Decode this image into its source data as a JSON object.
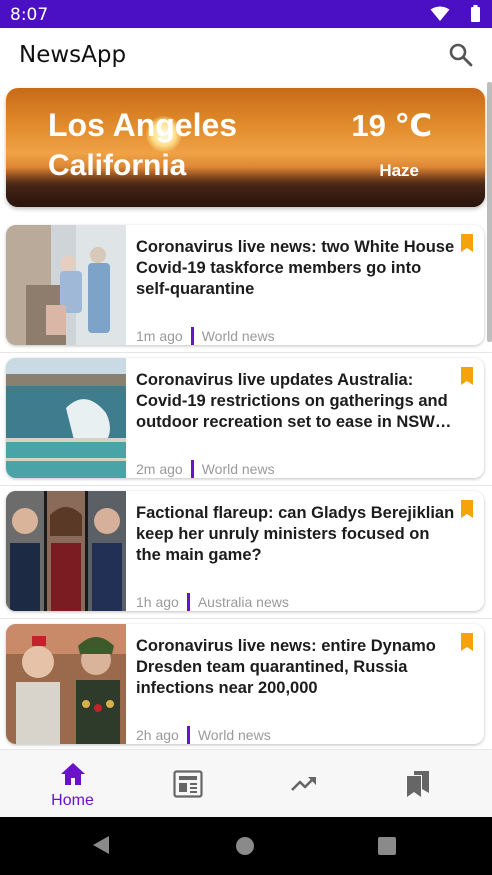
{
  "status_bar": {
    "time": "8:07"
  },
  "app_bar": {
    "title": "NewsApp",
    "search_icon": "search-icon"
  },
  "weather": {
    "city": "Los Angeles",
    "region": "California",
    "temperature": "19 ℃",
    "condition": "Haze"
  },
  "news": [
    {
      "headline": "Coronavirus live news: two White House Covid-19 taskforce members go into self-quarantine",
      "time": "1m ago",
      "category": "World news"
    },
    {
      "headline": "Coronavirus live updates Australia: Covid-19 restrictions on gatherings and outdoor recreation set to ease in NSW…",
      "time": "2m ago",
      "category": "World news"
    },
    {
      "headline": "Factional flareup: can Gladys Berejiklian keep her unruly ministers focused on the main game?",
      "time": "1h ago",
      "category": "Australia news"
    },
    {
      "headline": "Coronavirus live news: entire Dynamo Dresden team quarantined, Russia infections near 200,000",
      "time": "2h ago",
      "category": "World news"
    }
  ],
  "bottom_nav": [
    {
      "label": "Home",
      "icon": "home-icon",
      "active": true
    },
    {
      "label": "",
      "icon": "newspaper-icon",
      "active": false
    },
    {
      "label": "",
      "icon": "trending-icon",
      "active": false
    },
    {
      "label": "",
      "icon": "bookmarks-icon",
      "active": false
    }
  ],
  "colors": {
    "accent": "#6a12c9",
    "status_bar": "#4c10c4",
    "bookmark": "#f6a20a",
    "meta_text": "#9a9a9a",
    "inactive_icon": "#666666"
  }
}
